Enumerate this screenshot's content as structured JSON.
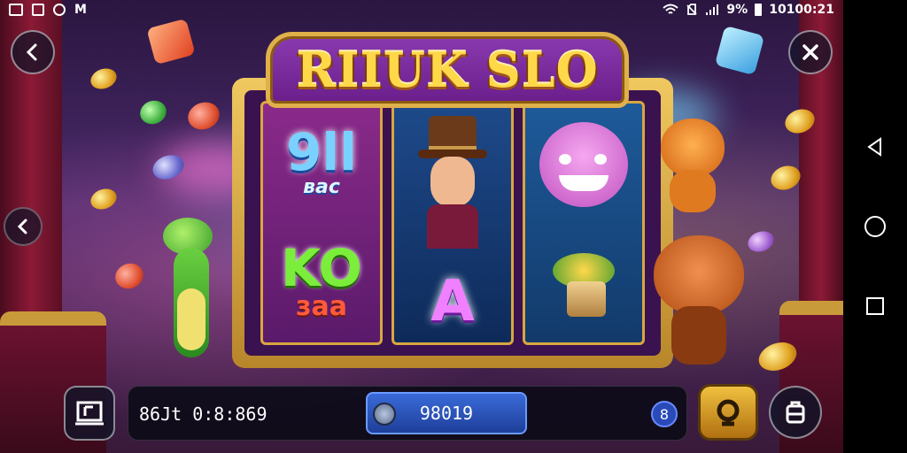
{
  "status_bar": {
    "battery_percent": "9%",
    "time": "10100:21",
    "left_letter": "M"
  },
  "game": {
    "title": "RIIUK SLO",
    "reels": [
      {
        "top": "9ll",
        "top_sub": "вас",
        "bottom": "KO",
        "bottom_sub": "заа"
      },
      {
        "top": "☺",
        "bottom": "A"
      },
      {
        "top": "☹",
        "bottom": "☘"
      }
    ]
  },
  "controls": {
    "balance_text": "86Jt 0:8:869",
    "bet_value": "98019",
    "lines_count": "8"
  },
  "icons": {
    "back": "chevron-left-icon",
    "close": "close-icon",
    "side_back": "chevron-left-icon",
    "menu": "menu-box-icon",
    "spin": "spin-icon",
    "bag": "bag-icon"
  },
  "colors": {
    "frame_gold": "#e0b04a",
    "title_plate": "#7a2aa0",
    "bet_blue": "#2a4ab8",
    "spin_gold": "#e0a020"
  }
}
